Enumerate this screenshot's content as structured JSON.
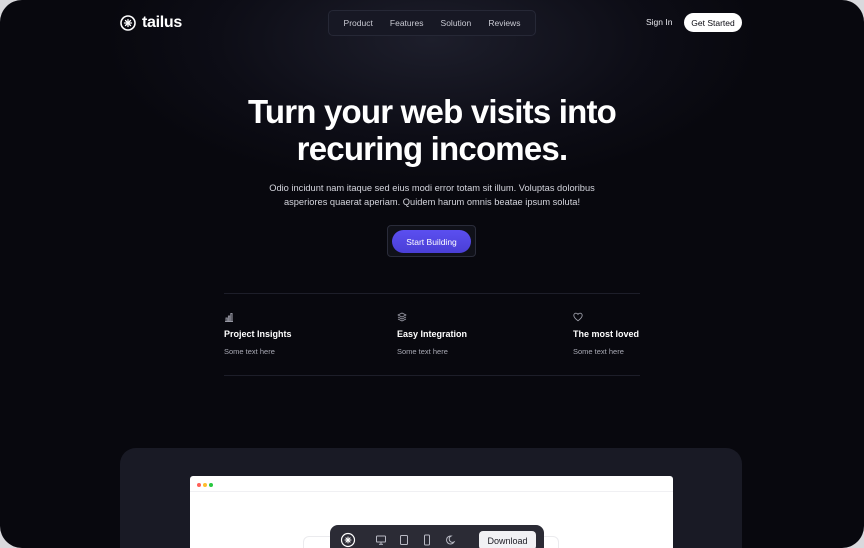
{
  "brand": {
    "name": "tailus"
  },
  "nav": {
    "items": [
      "Product",
      "Features",
      "Solution",
      "Reviews"
    ]
  },
  "header": {
    "signin_label": "Sign In",
    "get_started_label": "Get Started"
  },
  "hero": {
    "title_lines": [
      "Turn your web visits into",
      "recuring incomes."
    ],
    "description_lines": [
      "Odio incidunt nam itaque sed eius modi error totam sit illum. Voluptas doloribus",
      "asperiores quaerat aperiam. Quidem harum omnis beatae ipsum soluta!"
    ],
    "cta_label": "Start Building"
  },
  "features": [
    {
      "icon": "bar-chart-icon",
      "title": "Project Insights",
      "text": "Some text here"
    },
    {
      "icon": "layers-icon",
      "title": "Easy Integration",
      "text": "Some text here"
    },
    {
      "icon": "heart-icon",
      "title": "The most loved",
      "text": "Some text here"
    }
  ],
  "preview": {
    "window_dots": [
      "#ff5f57",
      "#febc2e",
      "#28c840"
    ],
    "toolbar_icons": [
      "logo-icon",
      "desktop-icon",
      "tablet-icon",
      "mobile-icon",
      "theme-toggle-icon"
    ],
    "download_label": "Download"
  },
  "colors": {
    "accent": "#4f46e5",
    "background": "#08080e",
    "panel": "#191a25"
  }
}
